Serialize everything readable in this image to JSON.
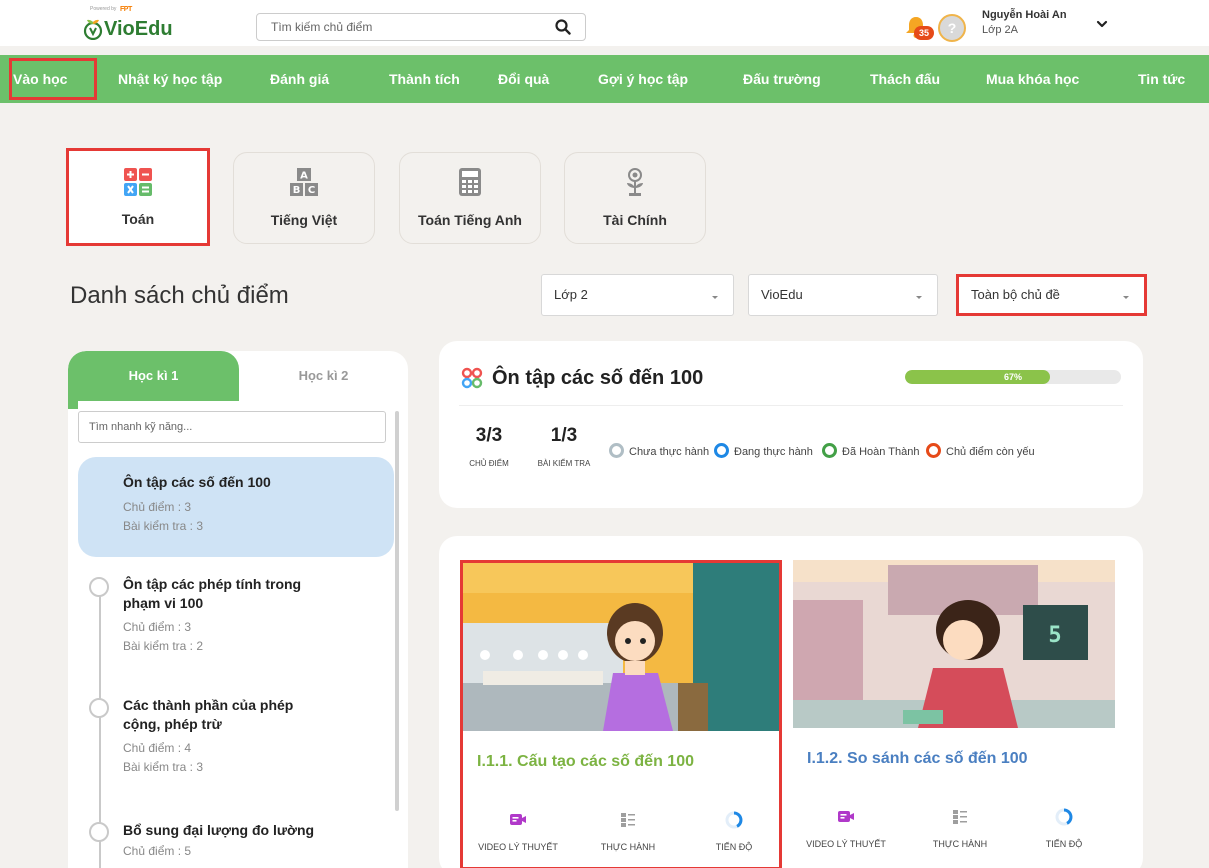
{
  "header": {
    "logo_small_text": "Powered by",
    "logo_fpt": "FPT",
    "logo_text_vio": "Vio",
    "logo_text_edu": "Edu",
    "search_placeholder": "Tìm kiếm chủ điểm",
    "notification_count": "35",
    "avatar_label": "?",
    "user_name": "Nguyễn Hoài An",
    "user_class": "Lớp 2A"
  },
  "nav": {
    "items": [
      "Vào học",
      "Nhật ký học tập",
      "Đánh giá",
      "Thành tích",
      "Đổi quà",
      "Gợi ý học tập",
      "Đấu trường",
      "Thách đấu",
      "Mua khóa học",
      "Tin tức"
    ],
    "active_index": 0
  },
  "subjects": [
    {
      "label": "Toán",
      "icon": "calculator-operations-icon",
      "active": true
    },
    {
      "label": "Tiếng Việt",
      "icon": "abc-blocks-icon",
      "active": false
    },
    {
      "label": "Toán Tiếng Anh",
      "icon": "calculator-icon",
      "active": false
    },
    {
      "label": "Tài Chính",
      "icon": "coin-plant-icon",
      "active": false
    }
  ],
  "section_title": "Danh sách chủ điểm",
  "filters": {
    "grade": "Lớp 2",
    "source": "VioEdu",
    "topic": "Toàn bộ chủ đề"
  },
  "sidebar": {
    "tabs": [
      "Học kì 1",
      "Học kì 2"
    ],
    "search_placeholder": "Tìm nhanh kỹ năng...",
    "topics": [
      {
        "title_lines": [
          "Ôn tập các số đến 100"
        ],
        "chu_diem": "Chủ điểm : 3",
        "bai_kiem_tra": "Bài kiểm tra : 3",
        "active": true
      },
      {
        "title_lines": [
          "Ôn tập các phép tính trong",
          "phạm vi 100"
        ],
        "chu_diem": "Chủ điểm : 3",
        "bai_kiem_tra": "Bài kiểm tra : 2",
        "active": false
      },
      {
        "title_lines": [
          "Các thành phần của phép",
          "cộng, phép trừ"
        ],
        "chu_diem": "Chủ điểm : 4",
        "bai_kiem_tra": "Bài kiểm tra : 3",
        "active": false
      },
      {
        "title_lines": [
          "Bổ sung đại lượng đo lường"
        ],
        "chu_diem": "Chủ điểm : 5",
        "bai_kiem_tra": "",
        "active": false
      }
    ]
  },
  "summary": {
    "title": "Ôn tập các số đến 100",
    "progress": 67,
    "progress_label": "67%",
    "chu_diem_value": "3/3",
    "chu_diem_label": "CHỦ ĐIỂM",
    "bai_kiem_tra_value": "1/3",
    "bai_kiem_tra_label": "BÀI KIỂM TRA",
    "legend": [
      {
        "label": "Chưa thực hành",
        "color": "#b0bec5"
      },
      {
        "label": "Đang thực hành",
        "color": "#1e88e5"
      },
      {
        "label": "Đã Hoàn Thành",
        "color": "#43a047"
      },
      {
        "label": "Chủ điểm còn yếu",
        "color": "#e64a19"
      }
    ]
  },
  "lessons": [
    {
      "title": "I.1.1. Cấu tạo các số đến 100",
      "title_color": "#7cb342",
      "actions": [
        "VIDEO LÝ THUYẾT",
        "THỰC HÀNH",
        "TIẾN ĐỘ"
      ]
    },
    {
      "title": "I.1.2. So sánh các số đến 100",
      "title_color": "#4a7fc1",
      "actions": [
        "VIDEO LÝ THUYẾT",
        "THỰC HÀNH",
        "TIẾN ĐỘ"
      ]
    }
  ],
  "colors": {
    "brand_green": "#6cc06a",
    "highlight_red": "#e53935",
    "progress_green": "#8bc34a"
  }
}
